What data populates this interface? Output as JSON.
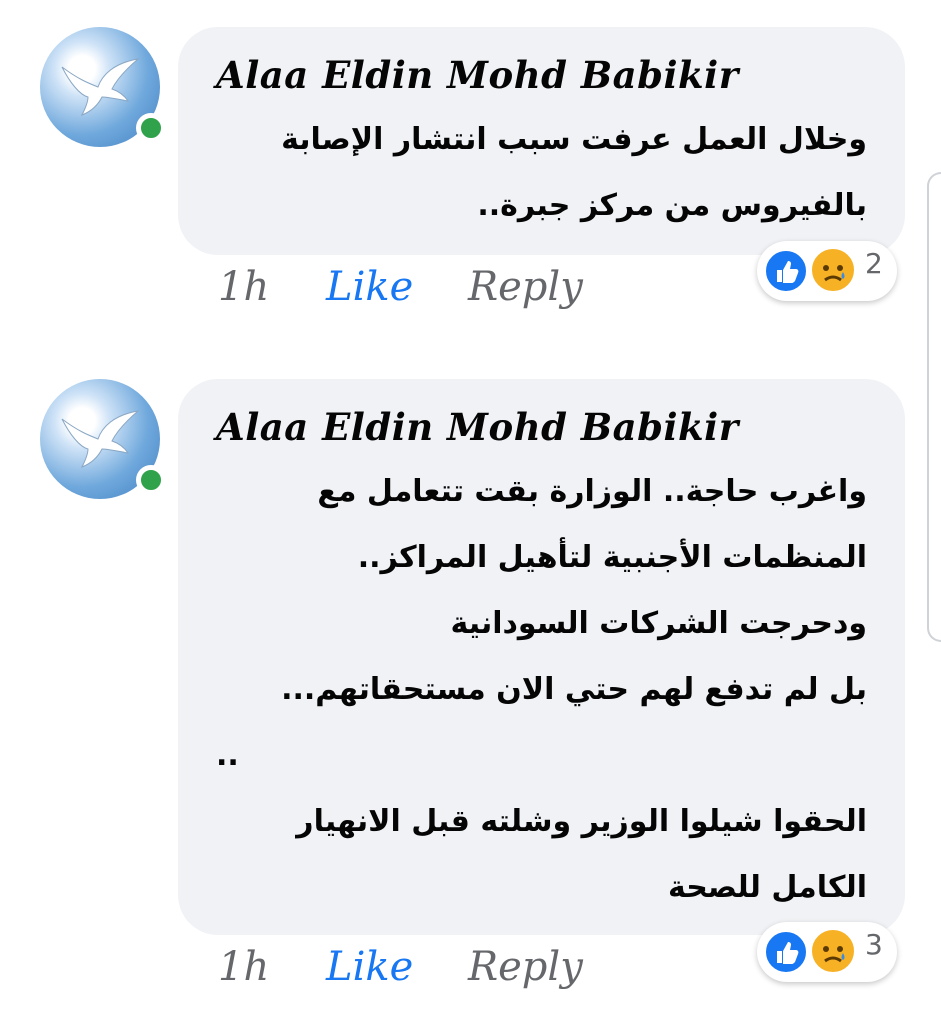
{
  "comments": [
    {
      "author": "Alaa Eldin Mohd Babikir",
      "lines": [
        "وخلال العمل عرفت سبب انتشار الإصابة",
        "بالفيروس من مركز جبرة.."
      ],
      "time": "1h",
      "like_label": "Like",
      "reply_label": "Reply",
      "reaction_count": "2",
      "reactions": [
        "like-reaction-icon",
        "sad-reaction-icon"
      ]
    },
    {
      "author": "Alaa Eldin Mohd Babikir",
      "lines": [
        "واغرب حاجة.. الوزارة بقت تتعامل مع",
        "المنظمات الأجنبية لتأهيل المراكز..",
        "ودحرجت الشركات السودانية",
        "بل لم تدفع لهم حتي الان مستحقاتهم...",
        "..",
        "الحقوا شيلوا الوزير وشلته قبل الانهيار",
        "الكامل للصحة"
      ],
      "time": "1h",
      "like_label": "Like",
      "reply_label": "Reply",
      "reaction_count": "3",
      "reactions": [
        "like-reaction-icon",
        "sad-reaction-icon"
      ]
    }
  ],
  "colors": {
    "bubble": "#f0f2f5",
    "online": "#31a24c",
    "like_blue": "#1877f2",
    "meta_gray": "#65676b",
    "sad_yellow": "#f7b125"
  }
}
